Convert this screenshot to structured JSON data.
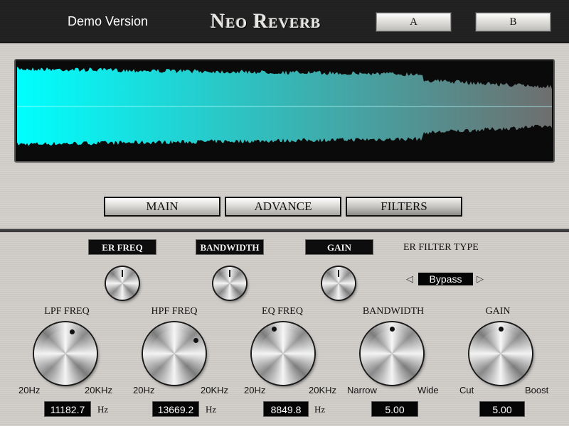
{
  "header": {
    "demo_label": "Demo Version",
    "title": "Neo Reverb",
    "preset_a": "A",
    "preset_b": "B"
  },
  "tabs": [
    "MAIN",
    "ADVANCE",
    "FILTERS"
  ],
  "active_tab": "FILTERS",
  "er_controls": {
    "er_freq": "ER FREQ",
    "bandwidth": "BANDWIDTH",
    "gain": "GAIN",
    "filter_type_label": "ER FILTER TYPE",
    "filter_type_value": "Bypass",
    "prev_arrow": "◁",
    "next_arrow": "▷"
  },
  "filters": [
    {
      "title": "LPF FREQ",
      "min": "20Hz",
      "max": "20KHz",
      "value": "11182.7",
      "unit": "Hz"
    },
    {
      "title": "HPF FREQ",
      "min": "20Hz",
      "max": "20KHz",
      "value": "13669.2",
      "unit": "Hz"
    },
    {
      "title": "EQ FREQ",
      "min": "20Hz",
      "max": "20KHz",
      "value": "8849.8",
      "unit": "Hz"
    },
    {
      "title": "BANDWIDTH",
      "min": "Narrow",
      "max": "Wide",
      "value": "5.00",
      "unit": ""
    },
    {
      "title": "GAIN",
      "min": "Cut",
      "max": "Boost",
      "value": "5.00",
      "unit": ""
    }
  ],
  "colors": {
    "waveform_start": "#00ffff",
    "waveform_end": "#6e6e6e",
    "panel": "#d2cfcb",
    "header_bg": "#222222"
  }
}
